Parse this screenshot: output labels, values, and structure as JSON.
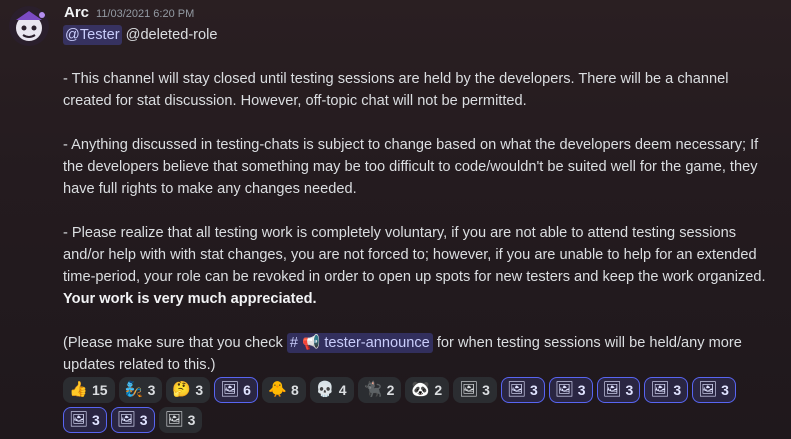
{
  "message": {
    "author": "Arc",
    "timestamp": "11/03/2021 6:20 PM",
    "mention_user": "@Tester",
    "mention_role": "@deleted-role",
    "paragraph1": "- This channel will stay closed until testing sessions are held by the developers. There will be a channel created for stat discussion. However, off-topic chat will not be permitted.",
    "paragraph2": "- Anything discussed in testing-chats is subject to change based on what the developers deem necessary; If the developers believe that something may be too difficult to code/wouldn't be suited well for the game, they have full rights to make any changes needed.",
    "paragraph3_text": "- Please realize that all testing work is completely voluntary, if you are not able to attend testing sessions and/or help with with stat changes, you are not forced to; however, if you are unable to help for an extended time-period, your role can be revoked in order to open up spots for new testers and keep the work organized.",
    "paragraph3_bold": "Your work is very much appreciated.",
    "paragraph4_before": "(Please make sure that you check",
    "channel_hash": "#",
    "channel_icon": "📢",
    "channel_name": "tester-announce",
    "paragraph4_after": "for when testing sessions will be held/any more updates related to this.)"
  },
  "reactions": [
    {
      "emoji": "👍",
      "icon_name": "thumbs-up-icon",
      "count": "15",
      "me": false
    },
    {
      "emoji": "🧞",
      "icon_name": "genie-icon",
      "count": "3",
      "me": false
    },
    {
      "emoji": "🤔",
      "icon_name": "thinking-face-icon",
      "count": "3",
      "me": false
    },
    {
      "emoji": "🖼",
      "icon_name": "custom-emoji-portrait-icon",
      "count": "6",
      "me": true
    },
    {
      "emoji": "🐥",
      "icon_name": "custom-emoji-chick-icon",
      "count": "8",
      "me": false
    },
    {
      "emoji": "💀",
      "icon_name": "custom-emoji-skull-icon",
      "count": "4",
      "me": false
    },
    {
      "emoji": "🐈‍⬛",
      "icon_name": "custom-emoji-black-cat-icon",
      "count": "2",
      "me": false
    },
    {
      "emoji": "🐼",
      "icon_name": "custom-emoji-panda-icon",
      "count": "2",
      "me": false
    },
    {
      "emoji": "🖼",
      "icon_name": "custom-emoji-photo-icon",
      "count": "3",
      "me": false
    },
    {
      "emoji": "🖼",
      "icon_name": "custom-emoji-photo-icon",
      "count": "3",
      "me": true
    },
    {
      "emoji": "🖼",
      "icon_name": "custom-emoji-photo-icon",
      "count": "3",
      "me": true
    },
    {
      "emoji": "🖼",
      "icon_name": "custom-emoji-photo-icon",
      "count": "3",
      "me": true
    },
    {
      "emoji": "🖼",
      "icon_name": "custom-emoji-photo-icon",
      "count": "3",
      "me": true
    },
    {
      "emoji": "🖼",
      "icon_name": "custom-emoji-photo-icon",
      "count": "3",
      "me": true
    },
    {
      "emoji": "🖼",
      "icon_name": "custom-emoji-photo-icon",
      "count": "3",
      "me": true
    },
    {
      "emoji": "🖼",
      "icon_name": "custom-emoji-photo-icon",
      "count": "3",
      "me": true
    },
    {
      "emoji": "🖼",
      "icon_name": "custom-emoji-photo-icon",
      "count": "3",
      "me": false
    }
  ],
  "colors": {
    "mention_bg": "#5865f2",
    "reaction_bg": "#2b2d31",
    "reaction_me_border": "#5865f2"
  }
}
